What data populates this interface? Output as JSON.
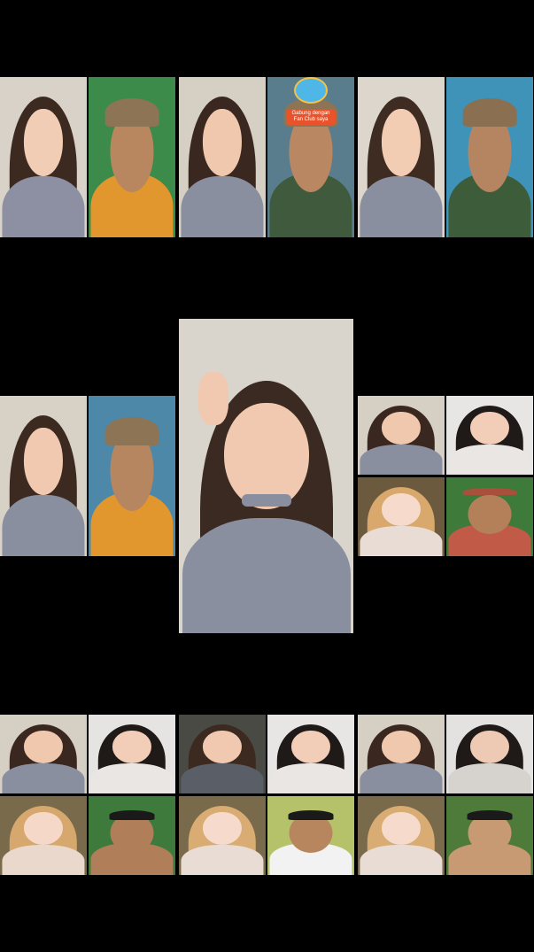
{
  "screen": {
    "background": "#000000"
  },
  "center_feed": {
    "background": "#d9d4cc",
    "skin": "#f0c9b0",
    "hair": "#3a2a22",
    "outfit": "#8a8fa0",
    "choker": "#8a8fa0"
  },
  "tiles": [
    {
      "name": "top-left-duet",
      "feeds": [
        {
          "kind": "woman",
          "bg": "#d8d2c8",
          "hair": "#3c2a20",
          "skin": "#f1cdb5",
          "outfit": "#8c90a2"
        },
        {
          "kind": "man-cap",
          "bg": "#3d8b4a",
          "hair": "#1a1a1a",
          "skin": "#b88760",
          "outfit": "#e2962e",
          "cap": "#8c7455"
        }
      ]
    },
    {
      "name": "top-center-duet",
      "badge": "Gabung dengan Fan Club saya",
      "feeds": [
        {
          "kind": "woman",
          "bg": "#d6d0c4",
          "hair": "#3a2820",
          "skin": "#f0c8ae",
          "outfit": "#8a8fa0"
        },
        {
          "kind": "man-cap",
          "bg": "#5a7d8e",
          "hair": "#1a1a1a",
          "skin": "#b98862",
          "outfit": "#3f5a3c",
          "cap": "#8c7455"
        }
      ]
    },
    {
      "name": "top-right-duet",
      "feeds": [
        {
          "kind": "woman",
          "bg": "#dcd6cc",
          "hair": "#3e2c22",
          "skin": "#f2cdb4",
          "outfit": "#8a8fa0"
        },
        {
          "kind": "man-cap",
          "bg": "#3f93b8",
          "hair": "#1a1a1a",
          "skin": "#b48560",
          "outfit": "#3d5c3a",
          "cap": "#8a7050"
        }
      ]
    },
    {
      "name": "mid-left-duet",
      "feeds": [
        {
          "kind": "woman",
          "bg": "#d8d2c6",
          "hair": "#3c2a20",
          "skin": "#f0c9b0",
          "outfit": "#8a8fa0"
        },
        {
          "kind": "man-cap",
          "bg": "#4d88a8",
          "hair": "#1a1a1a",
          "skin": "#b68660",
          "outfit": "#e2962e",
          "cap": "#8c7455"
        }
      ]
    },
    {
      "name": "mid-right-quad",
      "feeds": [
        {
          "kind": "woman",
          "bg": "#d6cfc4",
          "hair": "#3a2820",
          "skin": "#f0c8ae",
          "outfit": "#8a8fa0"
        },
        {
          "kind": "woman",
          "bg": "#e8e6e4",
          "hair": "#1f1a18",
          "skin": "#f2cdb8",
          "outfit": "#e9e6e4"
        },
        {
          "kind": "woman",
          "bg": "#6b5a3e",
          "hair": "#d8a86c",
          "skin": "#f6dacb",
          "outfit": "#e8dcd4"
        },
        {
          "kind": "man-headband",
          "bg": "#3e7a3a",
          "hair": "#1a1a1a",
          "skin": "#b4805a",
          "outfit": "#c25a48",
          "cap": "#a8503c"
        }
      ]
    },
    {
      "name": "bottom-left-quad",
      "feeds": [
        {
          "kind": "woman",
          "bg": "#d6d0c4",
          "hair": "#3a2820",
          "skin": "#f0c8ae",
          "outfit": "#8a8fa0"
        },
        {
          "kind": "woman",
          "bg": "#e6e4e2",
          "hair": "#1f1a18",
          "skin": "#f2cdb8",
          "outfit": "#e9e6e4"
        },
        {
          "kind": "woman",
          "bg": "#7a6a4c",
          "hair": "#d6a86e",
          "skin": "#f6d8c8",
          "outfit": "#ead8cc"
        },
        {
          "kind": "man",
          "bg": "#3d7a3c",
          "hair": "#1a1a1a",
          "skin": "#b07e58",
          "outfit": "#b07e58"
        }
      ]
    },
    {
      "name": "bottom-center-quad",
      "feeds": [
        {
          "kind": "woman",
          "bg": "#4a4a44",
          "hair": "#3c2a20",
          "skin": "#f0c9b0",
          "outfit": "#5a5e66"
        },
        {
          "kind": "woman",
          "bg": "#e8e6e4",
          "hair": "#1f1a18",
          "skin": "#f2cdb8",
          "outfit": "#e9e6e4"
        },
        {
          "kind": "woman",
          "bg": "#7a6a4c",
          "hair": "#d8ac72",
          "skin": "#f6dacb",
          "outfit": "#e8dcd4"
        },
        {
          "kind": "man-standing",
          "bg": "#b6c26a",
          "hair": "#1a1a1a",
          "skin": "#b8865e",
          "outfit": "#f2f2f2"
        }
      ]
    },
    {
      "name": "bottom-right-quad",
      "feeds": [
        {
          "kind": "woman",
          "bg": "#d6d0c4",
          "hair": "#3a2820",
          "skin": "#f0c8ae",
          "outfit": "#8a8fa0"
        },
        {
          "kind": "woman",
          "bg": "#e4e2e0",
          "hair": "#1f1a18",
          "skin": "#eec9b4",
          "outfit": "#d6d2ce"
        },
        {
          "kind": "woman",
          "bg": "#7a6a4c",
          "hair": "#d8ac72",
          "skin": "#f6dacb",
          "outfit": "#e8dcd4"
        },
        {
          "kind": "man-sitting",
          "bg": "#4e7a3a",
          "hair": "#1a1a1a",
          "skin": "#c89a74",
          "outfit": "#c89a74"
        }
      ]
    }
  ]
}
